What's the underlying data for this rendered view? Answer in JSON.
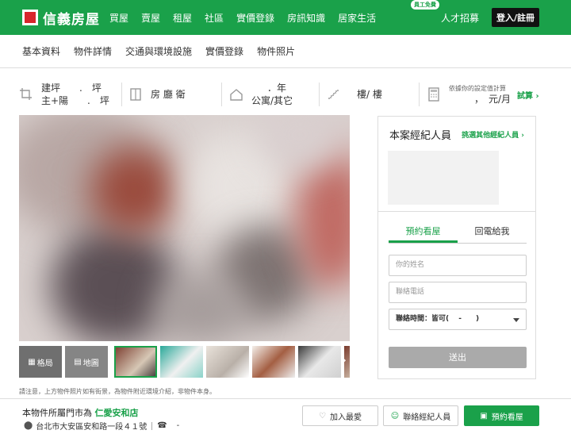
{
  "brand": {
    "name": "信義房屋",
    "logo_color": "#d7262c",
    "accent": "#1aa14a"
  },
  "nav": {
    "items": [
      "買屋",
      "賣屋",
      "租屋",
      "社區",
      "實價登錄",
      "房訊知識",
      "居家生活"
    ]
  },
  "nav_right": {
    "talent_badge": "員工免費",
    "talent": "人才招募",
    "login": "登入/註冊"
  },
  "subnav": {
    "items": [
      "基本資料",
      "物件詳情",
      "交通與環境設施",
      "實價登錄",
      "物件照片"
    ]
  },
  "info": {
    "area_line1": "建坪　　.　坪",
    "area_line2": "主+陽　　.　坪",
    "layout": "房 廳 衛",
    "age_line1": "．年",
    "age_line2": "公寓/其它",
    "floor": "樓/ 樓",
    "calc_label": "依據你的設定值計算",
    "calc_value": "，　元/月",
    "calc_link": "試算"
  },
  "thumbs": {
    "layout_label": "格局",
    "map_label": "地圖"
  },
  "notice": "請注意，上方物件照片如有街景，為物件附近環境介紹，非物件本身。",
  "agent": {
    "title": "本案經紀人員",
    "pick_link": "挑選其他經紀人員",
    "tab_book": "預約看屋",
    "tab_call": "回電給我",
    "name_placeholder": "你的姓名",
    "phone_placeholder": "聯絡電話",
    "time_value": "聯絡時間：皆可(　 -　　)",
    "submit": "送出"
  },
  "bottom": {
    "district_prefix": "本物件所屬門市為",
    "district": "仁愛安和店",
    "address": "台北市大安區安和路一段４１號",
    "phone": "-",
    "fav": "加入最愛",
    "contact": "聯絡經紀人員",
    "book": "預約看屋"
  }
}
